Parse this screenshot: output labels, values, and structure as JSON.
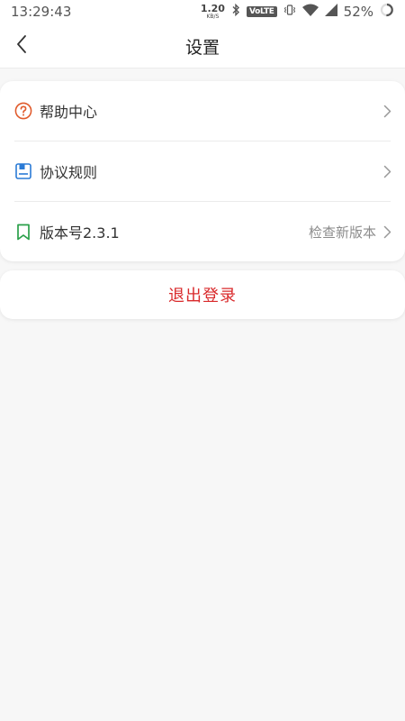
{
  "status_bar": {
    "time": "13:29:43",
    "net_speed": "1.20",
    "net_unit": "KB/S",
    "volte": "VoLTE",
    "battery": "52%"
  },
  "nav": {
    "title": "设置",
    "back_icon": "chevron-left-icon"
  },
  "settings": {
    "items": [
      {
        "label": "帮助中心",
        "icon": "help-circle-icon",
        "icon_color": "#e05a2b"
      },
      {
        "label": "协议规则",
        "icon": "document-icon",
        "icon_color": "#2b7bd6"
      },
      {
        "label": "版本号2.3.1",
        "icon": "bookmark-icon",
        "icon_color": "#2aa04a",
        "value": "检查新版本"
      }
    ]
  },
  "logout": {
    "label": "退出登录",
    "color": "#d9292b"
  }
}
